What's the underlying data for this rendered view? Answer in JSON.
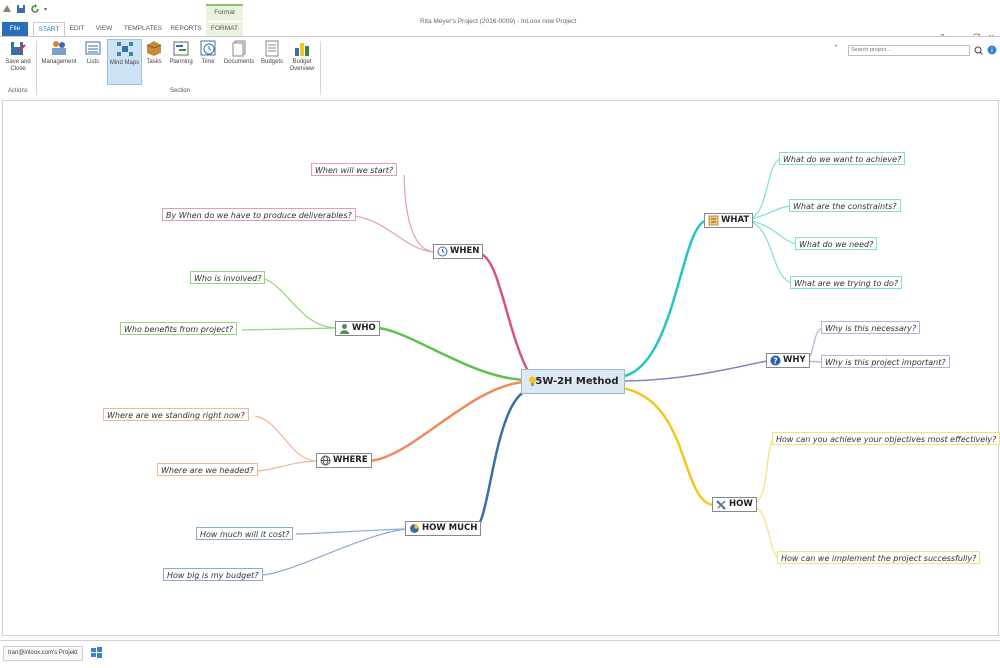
{
  "window": {
    "title": "Rita Meyer's Project  (2016-0009) - InLoox now Project",
    "context_tab_group": "Format"
  },
  "tabs": [
    "File",
    "START",
    "EDIT",
    "VIEW",
    "TEMPLATES",
    "REPORTS",
    "FORMAT"
  ],
  "ribbon": {
    "actions": {
      "save_close": "Save and Close",
      "group_label": "Actions"
    },
    "section": {
      "buttons": [
        "Management",
        "Lists",
        "Mind Maps",
        "Tasks",
        "Planning",
        "Time",
        "Documents",
        "Budgets",
        "Budget Overview"
      ],
      "group_label": "Section"
    },
    "search_placeholder": "Search project..."
  },
  "mindmap": {
    "center": "5W-2H Method",
    "branches": {
      "when": {
        "label": "WHEN",
        "color": "#d9547a",
        "children": [
          "When will we start?",
          "By When do we have to produce deliverables?"
        ]
      },
      "who": {
        "label": "WHO",
        "color": "#5cc24a",
        "children": [
          "Who is involved?",
          "Who benefits from project?"
        ]
      },
      "where": {
        "label": "WHERE",
        "color": "#f08a5a",
        "children": [
          "Where are we standing right now?",
          "Where are we headed?"
        ]
      },
      "howmuch": {
        "label": "HOW MUCH",
        "color": "#3a6ea8",
        "children": [
          "How much will it cost?",
          "How big is my budget?"
        ]
      },
      "what": {
        "label": "WHAT",
        "color": "#22c4c4",
        "children": [
          "What do we want to achieve?",
          "What are the constraints?",
          "What do we need?",
          "What are we trying to do?"
        ]
      },
      "why": {
        "label": "WHY",
        "color": "#8a7fc0",
        "children": [
          "Why is this necessary?",
          "Why is this project important?"
        ]
      },
      "how": {
        "label": "HOW",
        "color": "#f2c81e",
        "children": [
          "How can you achieve your objectives most effectively?",
          "How can we implement the project successfully?"
        ]
      }
    }
  },
  "status": {
    "user": "tran@inloox.com's Projekt"
  },
  "icons": [
    "app-icon",
    "save-icon",
    "refresh-icon",
    "help-icon",
    "minimize-icon",
    "restore-icon",
    "close-icon",
    "search-icon",
    "info-icon"
  ]
}
